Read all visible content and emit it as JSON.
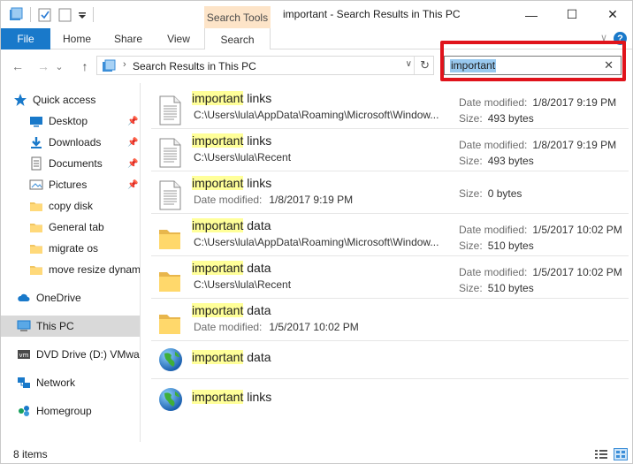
{
  "window": {
    "title": "important - Search Results in This PC",
    "minimize_glyph": "—",
    "maximize_glyph": "☐",
    "close_glyph": "✕"
  },
  "ribbon": {
    "context_group": "Search Tools",
    "tabs": {
      "file": "File",
      "home": "Home",
      "share": "Share",
      "view": "View",
      "search": "Search"
    },
    "help_glyph": "?",
    "collapse_glyph": "∨"
  },
  "nav": {
    "back_glyph": "←",
    "forward_glyph": "→",
    "recent_glyph": "⌄",
    "up_glyph": "↑",
    "address_sep": "›",
    "address": "Search Results in This PC",
    "address_drop": "∨",
    "refresh_glyph": "↻"
  },
  "search": {
    "value": "important",
    "clear_glyph": "✕"
  },
  "sidebar": {
    "pin_glyph": "📌",
    "items": [
      {
        "label": "Quick access",
        "icon": "star-icon"
      },
      {
        "label": "Desktop",
        "icon": "desktop-icon",
        "pinned": true
      },
      {
        "label": "Downloads",
        "icon": "download-icon",
        "pinned": true
      },
      {
        "label": "Documents",
        "icon": "documents-icon",
        "pinned": true
      },
      {
        "label": "Pictures",
        "icon": "pictures-icon",
        "pinned": true
      },
      {
        "label": "copy disk",
        "icon": "folder-icon"
      },
      {
        "label": "General tab",
        "icon": "folder-icon"
      },
      {
        "label": "migrate os",
        "icon": "folder-icon"
      },
      {
        "label": "move resize dynam",
        "icon": "folder-icon"
      },
      {
        "label": "OneDrive",
        "icon": "cloud-icon"
      },
      {
        "label": "This PC",
        "icon": "computer-icon",
        "selected": true
      },
      {
        "label": "DVD Drive (D:) VMwa",
        "icon": "dvd-icon"
      },
      {
        "label": "Network",
        "icon": "network-icon"
      },
      {
        "label": "Homegroup",
        "icon": "homegroup-icon"
      }
    ]
  },
  "results": {
    "highlight": "important",
    "label_date": "Date modified:",
    "label_size": "Size:",
    "rows": [
      {
        "rest": " links",
        "icon": "document-icon",
        "path": "C:\\Users\\lula\\AppData\\Roaming\\Microsoft\\Window...",
        "date": "1/8/2017 9:19 PM",
        "size": "493 bytes"
      },
      {
        "rest": " links",
        "icon": "document-icon",
        "path": "C:\\Users\\lula\\Recent",
        "date": "1/8/2017 9:19 PM",
        "size": "493 bytes"
      },
      {
        "rest": " links",
        "icon": "document-icon",
        "sub_date": "1/8/2017 9:19 PM",
        "size": "0 bytes"
      },
      {
        "rest": " data",
        "icon": "folder-icon",
        "path": "C:\\Users\\lula\\AppData\\Roaming\\Microsoft\\Window...",
        "date": "1/5/2017 10:02 PM",
        "size": "510 bytes"
      },
      {
        "rest": " data",
        "icon": "folder-icon",
        "path": "C:\\Users\\lula\\Recent",
        "date": "1/5/2017 10:02 PM",
        "size": "510 bytes"
      },
      {
        "rest": " data",
        "icon": "folder-icon",
        "sub_date": "1/5/2017 10:02 PM"
      },
      {
        "rest": " data",
        "icon": "globe-icon"
      },
      {
        "rest": " links",
        "icon": "globe-icon"
      }
    ]
  },
  "status": {
    "count": "8 items"
  },
  "colors": {
    "accent": "#1979ca",
    "context_tab": "#fde4c8",
    "search_highlight": "#ffff99",
    "callout": "#e0131b",
    "selection": "#99c9ef"
  }
}
